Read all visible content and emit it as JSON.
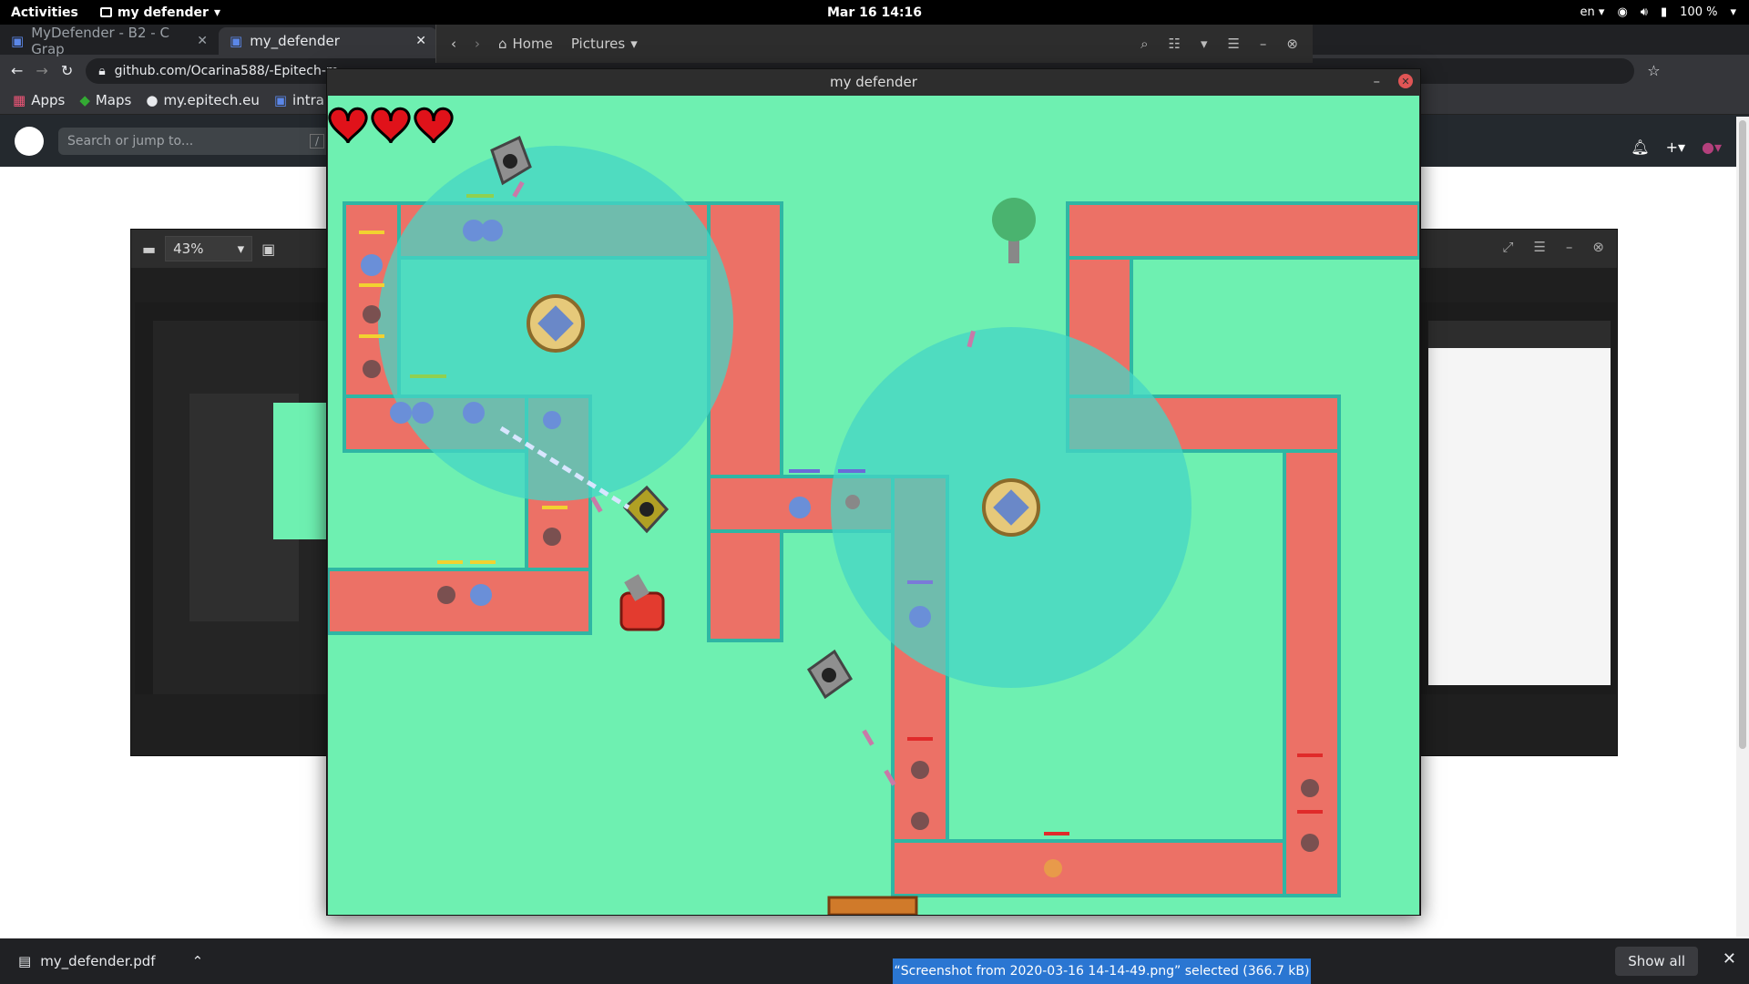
{
  "topbar": {
    "activities": "Activities",
    "app_name": "my defender",
    "clock": "Mar 16  14:16",
    "lang": "en",
    "battery": "100 %"
  },
  "chrome": {
    "tabs": [
      {
        "label": "MyDefender - B2 - C Grap"
      },
      {
        "label": "my_defender"
      }
    ],
    "url": "github.com/Ocarina588/-Epitech-m",
    "bookmarks": [
      {
        "label": "Apps"
      },
      {
        "label": "Maps"
      },
      {
        "label": "my.epitech.eu"
      },
      {
        "label": "intra"
      }
    ],
    "github_search_placeholder": "Search or jump to...",
    "github_search_shortcut": "/"
  },
  "viewer": {
    "zoom": "43%"
  },
  "nautilus": {
    "home": "Home",
    "folder": "Pictures"
  },
  "game": {
    "window_title": "my defender",
    "hearts": 3
  },
  "downloads": {
    "file": "my_defender.pdf",
    "show_all": "Show all"
  },
  "toast": {
    "message": "“Screenshot from 2020-03-16 14-14-49.png” selected  (366.7 kB)"
  },
  "colors": {
    "grass": "#6ef0b1",
    "path": "#ec7166",
    "path_shadow": "#9a8fa6",
    "range": "#45d6c6",
    "heart": "#e0121a"
  }
}
